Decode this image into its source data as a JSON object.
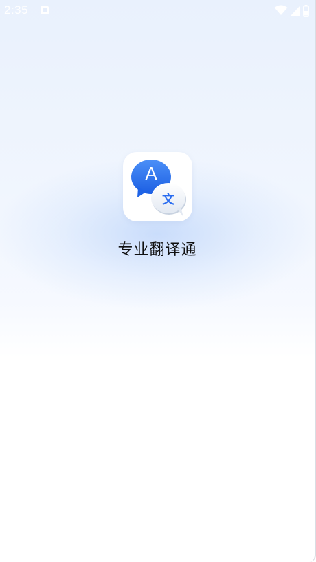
{
  "status_bar": {
    "time": "2:35",
    "icons": [
      "notification-icon",
      "wifi-icon",
      "signal-icon",
      "battery-icon"
    ]
  },
  "splash": {
    "app_name": "专业翻译通",
    "logo": {
      "bubble_a_letter": "A",
      "bubble_b_letter": "文"
    }
  },
  "colors": {
    "logo_blue": "#1f63e6",
    "logo_blue_light": "#3d86f5",
    "text_primary": "#111111"
  }
}
